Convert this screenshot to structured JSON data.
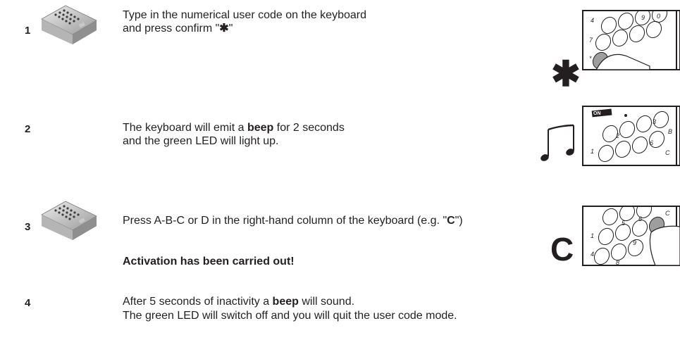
{
  "steps": [
    {
      "number": "1",
      "line1": "Type in the numerical user code on the keyboard",
      "line2_pre": "and press confirm \"",
      "line2_bold": "✱",
      "line2_post": "\""
    },
    {
      "number": "2",
      "line1_pre": "The keyboard will emit a ",
      "line1_bold": "beep",
      "line1_post": " for 2 seconds",
      "line2": "and the green LED will light up."
    },
    {
      "number": "3",
      "line1_pre": "Press A-B-C or D in the right-hand column of the keyboard (e.g. \"",
      "line1_bold": "C",
      "line1_post": "\")",
      "note": "Activation has been carried out!"
    },
    {
      "number": "4",
      "line1_pre": "After 5 seconds of inactivity a ",
      "line1_bold": "beep",
      "line1_post": " will sound.",
      "line2": "The green LED will switch off and you will quit the user code mode."
    }
  ],
  "symbols": {
    "star": "✱",
    "letter_c": "C"
  },
  "thumb_labels": {
    "on": "ON",
    "digits_1": [
      "4",
      "9",
      "0",
      "7",
      "*"
    ],
    "digits_2": [
      "3",
      "2",
      "B",
      "6",
      "1",
      "C"
    ],
    "digits_3": [
      "5",
      "6",
      "C",
      "1",
      "4",
      "9",
      "8"
    ]
  },
  "icons": {
    "keypad": "keypad-device-icon",
    "music": "music-note-icon",
    "finger": "finger-press-icon"
  }
}
